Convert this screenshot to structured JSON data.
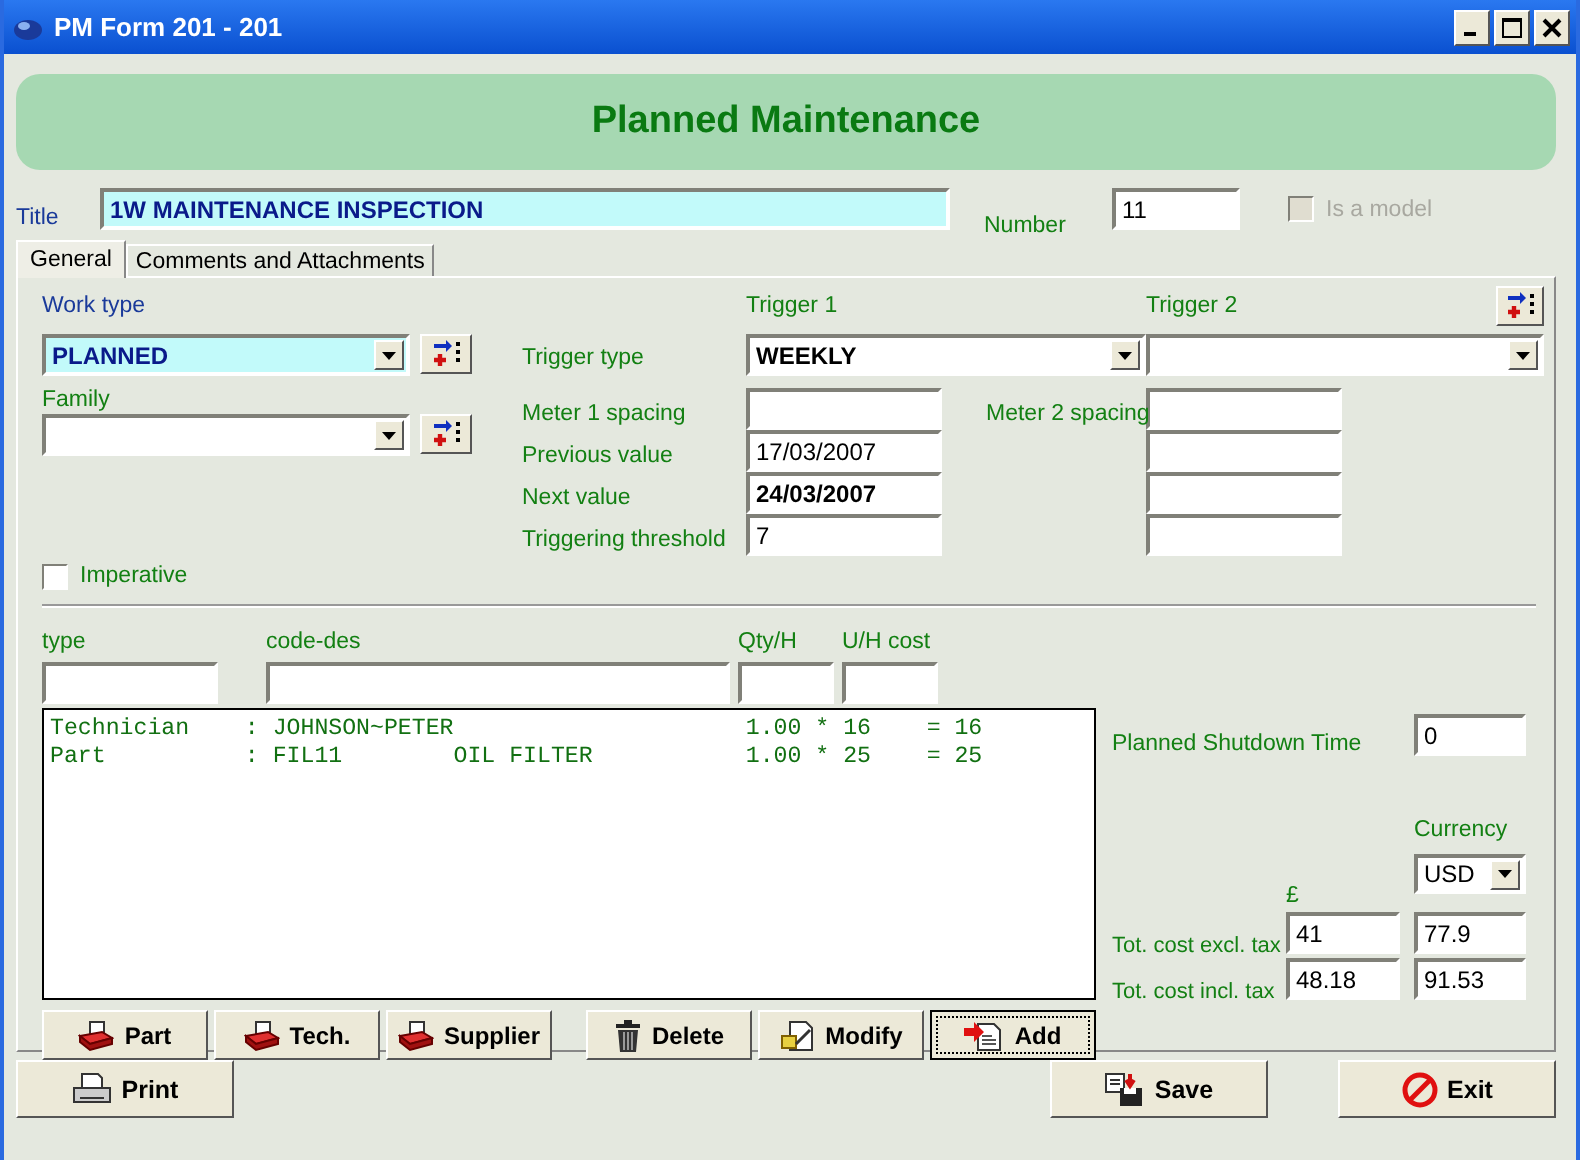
{
  "window": {
    "title": "PM Form 201 - 201"
  },
  "banner": "Planned Maintenance",
  "title_field": {
    "label": "Title",
    "value": "1W MAINTENANCE INSPECTION"
  },
  "number": {
    "label": "Number",
    "value": "11"
  },
  "is_model": {
    "label": "Is a model",
    "checked": false,
    "disabled": true
  },
  "tabs": [
    {
      "label": "General",
      "selected": true
    },
    {
      "label": "Comments and Attachments",
      "selected": false
    }
  ],
  "work_type": {
    "label": "Work type",
    "value": "PLANNED"
  },
  "family": {
    "label": "Family"
  },
  "imperative": {
    "label": "Imperative",
    "checked": false
  },
  "trigger": {
    "trigger_1_label": "Trigger 1",
    "trigger_2_label": "Trigger 2",
    "type_label": "Trigger type",
    "type_1": "WEEKLY",
    "meter_2_label": "Meter 2 spacing"
  },
  "trigger_rows": [
    {
      "label": "Meter 1 spacing"
    },
    {
      "label": "Previous value",
      "value": "17/03/2007",
      "bold": false
    },
    {
      "label": "Next value",
      "value": "24/03/2007",
      "bold": true
    },
    {
      "label": "Triggering threshold",
      "value": "7",
      "bold": false
    }
  ],
  "entry_labels": [
    "type",
    "code-des",
    "Qty/H",
    "U/H cost"
  ],
  "list_lines": [
    "Technician    : JOHNSON~PETER                     1.00 * 16    = 16",
    "Part          : FIL11        OIL FILTER           1.00 * 25    = 25"
  ],
  "item_buttons": [
    {
      "label": "Part",
      "kind": "tray",
      "focused": false
    },
    {
      "label": "Tech.",
      "kind": "tray",
      "focused": false
    },
    {
      "label": "Supplier",
      "kind": "tray",
      "focused": false
    },
    {
      "label": "Delete",
      "kind": "trash",
      "focused": false
    },
    {
      "label": "Modify",
      "kind": "edit",
      "focused": false
    },
    {
      "label": "Add",
      "kind": "add",
      "focused": true
    }
  ],
  "shutdown": {
    "label": "Planned Shutdown Time",
    "value": "0"
  },
  "currency": {
    "label": "Currency",
    "value": "USD",
    "base_symbol": "£"
  },
  "costs": [
    {
      "label": "Tot. cost excl. tax",
      "base": "41",
      "converted": "77.9"
    },
    {
      "label": "Tot. cost incl. tax",
      "base": "48.18",
      "converted": "91.53"
    }
  ],
  "footer_buttons": [
    {
      "label": "Print",
      "kind": "print"
    },
    {
      "label": "Save",
      "kind": "save"
    },
    {
      "label": "Exit",
      "kind": "exit"
    }
  ]
}
